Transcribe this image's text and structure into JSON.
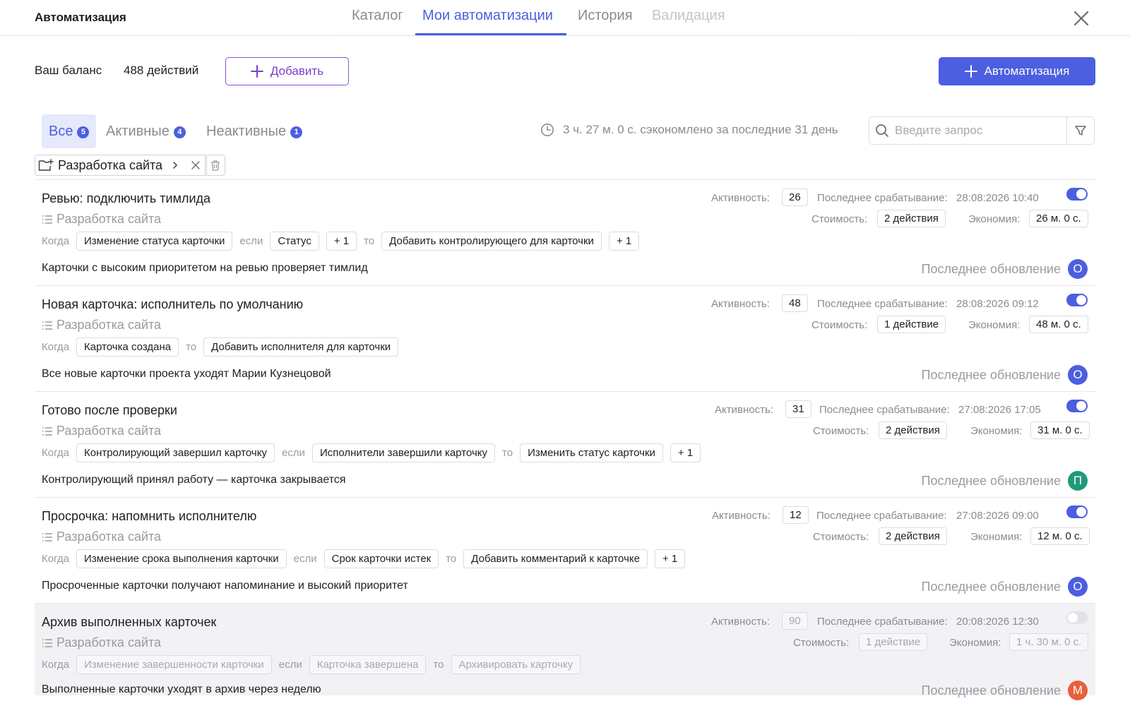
{
  "header": {
    "title": "Автоматизация",
    "tabs": [
      {
        "label": "Каталог",
        "state": "normal"
      },
      {
        "label": "Мои автоматизации",
        "state": "active"
      },
      {
        "label": "История",
        "state": "normal"
      },
      {
        "label": "Валидация",
        "state": "disabled"
      }
    ]
  },
  "balance": {
    "label": "Ваш баланс",
    "value": "488 действий",
    "add_label": "Добавить",
    "create_label": "Автоматизация"
  },
  "filters": {
    "all": {
      "label": "Все",
      "count": "5"
    },
    "active": {
      "label": "Активные",
      "count": "4"
    },
    "inactive": {
      "label": "Неактивные",
      "count": "1"
    },
    "saved_time": "3 ч. 27 м. 0 с. сэкономлено за последние 31 день",
    "search_placeholder": "Введите запрос"
  },
  "project_chip": {
    "label": "Разработка сайта"
  },
  "labels": {
    "activity": "Активность:",
    "last_trigger": "Последнее срабатывание:",
    "cost": "Стоимость:",
    "saving": "Экономия:",
    "last_update": "Последнее обновление",
    "when": "Когда",
    "if": "если",
    "then": "то"
  },
  "colors": {
    "accent": "#4b5fe0",
    "avatar_o": "#4b5fe0",
    "avatar_p": "#1f9a7a",
    "avatar_m": "#e8603c"
  },
  "automations": [
    {
      "title": "Ревью: подключить тимлида",
      "project": "Разработка сайта",
      "trigger": "Изменение статуса карточки",
      "condition": "Статус",
      "condition_more": "+ 1",
      "action": "Добавить контролирующего для карточки",
      "action_more": "+ 1",
      "description": "Карточки с высоким приоритетом на ревью проверяет тимлид",
      "activity": "26",
      "last_trigger": "28:08:2026 10:40",
      "cost": "2 действия",
      "saving": "26 м. 0 с.",
      "avatar": "О",
      "enabled": true
    },
    {
      "title": "Новая карточка: исполнитель по умолчанию",
      "project": "Разработка сайта",
      "trigger": "Карточка создана",
      "action": "Добавить исполнителя для карточки",
      "description": "Все новые карточки проекта уходят Марии Кузнецовой",
      "activity": "48",
      "last_trigger": "28:08:2026 09:12",
      "cost": "1 действие",
      "saving": "48 м. 0 с.",
      "avatar": "О",
      "enabled": true
    },
    {
      "title": "Готово после проверки",
      "project": "Разработка сайта",
      "trigger": "Контролирующий завершил карточку",
      "condition": "Исполнители завершили карточку",
      "action": "Изменить статус карточки",
      "action_more": "+ 1",
      "description": "Контролирующий принял работу — карточка закрывается",
      "activity": "31",
      "last_trigger": "27:08:2026 17:05",
      "cost": "2 действия",
      "saving": "31 м. 0 с.",
      "avatar": "П",
      "enabled": true
    },
    {
      "title": "Просрочка: напомнить исполнителю",
      "project": "Разработка сайта",
      "trigger": "Изменение срока выполнения карточки",
      "condition": "Срок карточки истек",
      "action": "Добавить комментарий к карточке",
      "action_more": "+ 1",
      "description": "Просроченные карточки получают напоминание и высокий приоритет",
      "activity": "12",
      "last_trigger": "27:08:2026 09:00",
      "cost": "2 действия",
      "saving": "12 м. 0 с.",
      "avatar": "О",
      "enabled": true
    },
    {
      "title": "Архив выполненных карточек",
      "project": "Разработка сайта",
      "trigger": "Изменение завершенности карточки",
      "condition": "Карточка завершена",
      "action": "Архивировать карточку",
      "description": "Выполненные карточки уходят в архив через неделю",
      "activity": "90",
      "last_trigger": "20:08:2026 12:30",
      "cost": "1 действие",
      "saving": "1 ч. 30 м. 0 с.",
      "avatar": "М",
      "enabled": false
    }
  ]
}
